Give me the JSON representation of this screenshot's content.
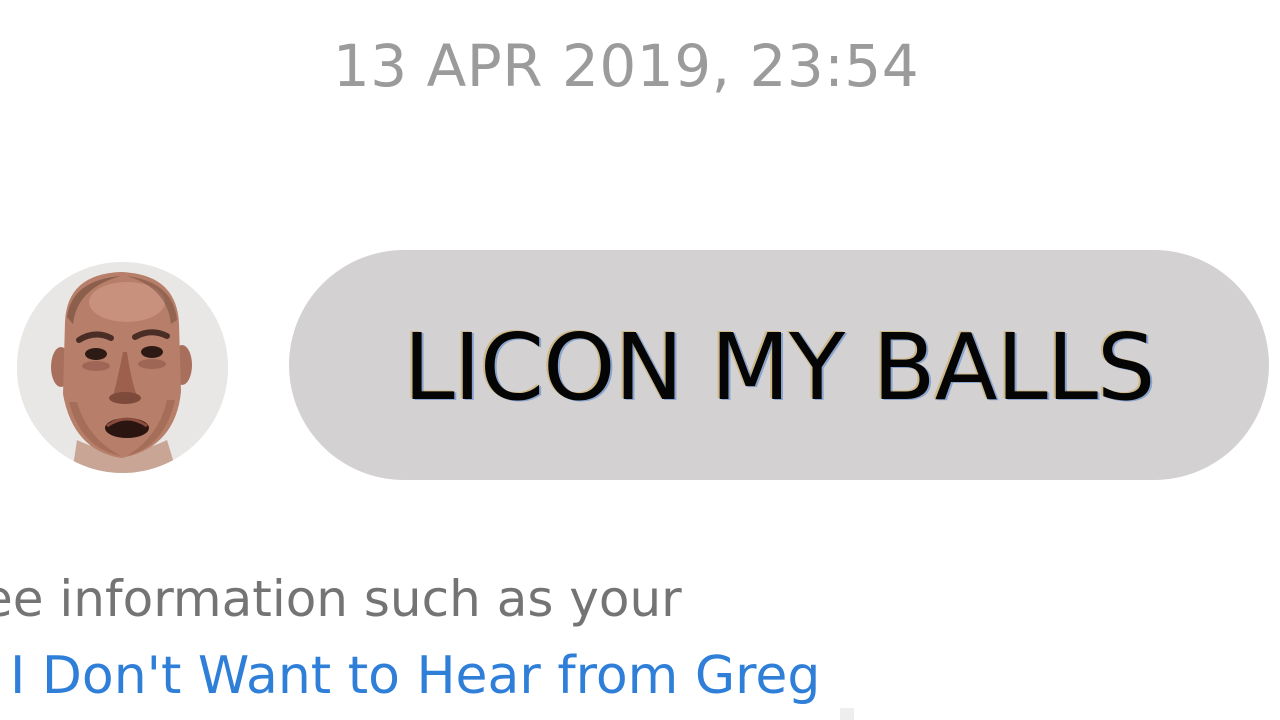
{
  "conversation": {
    "timestamp": "13 APR 2019, 23:54"
  },
  "message": {
    "text": "LICON MY BALLS"
  },
  "footer": {
    "info_text": "ee information such as your",
    "link_label": "I Don't Want to Hear from Greg"
  },
  "colors": {
    "timestamp": "#9b9b9b",
    "bubble_background": "#d3d1d2",
    "message_text": "#050505",
    "info_text": "#747474",
    "link": "#2f7fd9",
    "page_background": "#ffffff"
  },
  "icons": {
    "avatar": "user-photo-avatar"
  }
}
